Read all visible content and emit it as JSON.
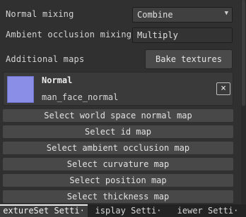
{
  "properties": {
    "normal_mixing": {
      "label": "Normal mixing",
      "value": "Combine"
    },
    "ambient_occlusion_mixing": {
      "label": "Ambient occlusion mixing",
      "value": "Multiply"
    },
    "additional_maps": {
      "label": "Additional maps",
      "bake_button": "Bake textures"
    }
  },
  "map_card": {
    "title": "Normal",
    "file": "man_face_normal",
    "thumbnail_color": "#8a8ee6",
    "close_icon": "×"
  },
  "select_buttons": [
    "Select world space normal map",
    "Select id map",
    "Select ambient occlusion map",
    "Select curvature map",
    "Select position map",
    "Select thickness map"
  ],
  "tabs": [
    {
      "label": "extureSet Setti·",
      "active": true
    },
    {
      "label": "isplay Setti·",
      "active": false
    },
    {
      "label": "iewer Setti·",
      "active": false
    }
  ]
}
